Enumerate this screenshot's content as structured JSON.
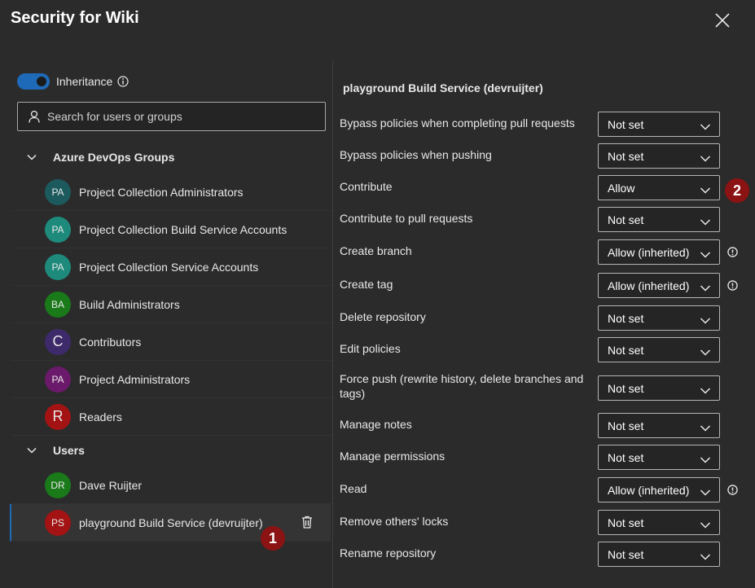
{
  "dialog": {
    "title": "Security for Wiki"
  },
  "left": {
    "inheritance_label": "Inheritance",
    "search_placeholder": "Search for users or groups",
    "groups_header": "Azure DevOps Groups",
    "users_header": "Users",
    "groups": [
      {
        "initials": "PA",
        "name": "Project Collection Administrators",
        "color": "#1c5a5e"
      },
      {
        "initials": "PA",
        "name": "Project Collection Build Service Accounts",
        "color": "#1e8a7c"
      },
      {
        "initials": "PA",
        "name": "Project Collection Service Accounts",
        "color": "#1e8a7c"
      },
      {
        "initials": "BA",
        "name": "Build Administrators",
        "color": "#1a7a1a"
      },
      {
        "initials": "C",
        "name": "Contributors",
        "color": "#3d2a6b"
      },
      {
        "initials": "PA",
        "name": "Project Administrators",
        "color": "#6b1a6b"
      },
      {
        "initials": "R",
        "name": "Readers",
        "color": "#a31313"
      }
    ],
    "users": [
      {
        "initials": "DR",
        "name": "Dave Ruijter",
        "color": "#1a7a1a"
      },
      {
        "initials": "PS",
        "name": "playground Build Service (devruijter)",
        "color": "#a31313"
      }
    ],
    "badge1": "1"
  },
  "right": {
    "title": "playground Build Service (devruijter)",
    "badge2": "2",
    "permissions": [
      {
        "label": "Bypass policies when completing pull requests",
        "value": "Not set"
      },
      {
        "label": "Bypass policies when pushing",
        "value": "Not set"
      },
      {
        "label": "Contribute",
        "value": "Allow"
      },
      {
        "label": "Contribute to pull requests",
        "value": "Not set"
      },
      {
        "label": "Create branch",
        "value": "Allow (inherited)"
      },
      {
        "label": "Create tag",
        "value": "Allow (inherited)"
      },
      {
        "label": "Delete repository",
        "value": "Not set"
      },
      {
        "label": "Edit policies",
        "value": "Not set"
      },
      {
        "label": "Force push (rewrite history, delete branches and tags)",
        "value": "Not set"
      },
      {
        "label": "Manage notes",
        "value": "Not set"
      },
      {
        "label": "Manage permissions",
        "value": "Not set"
      },
      {
        "label": "Read",
        "value": "Allow (inherited)"
      },
      {
        "label": "Remove others' locks",
        "value": "Not set"
      },
      {
        "label": "Rename repository",
        "value": "Not set"
      }
    ]
  },
  "colors": {
    "accent": "#1f6ab8",
    "badge": "#8b1313",
    "background": "#2b2b2b"
  }
}
